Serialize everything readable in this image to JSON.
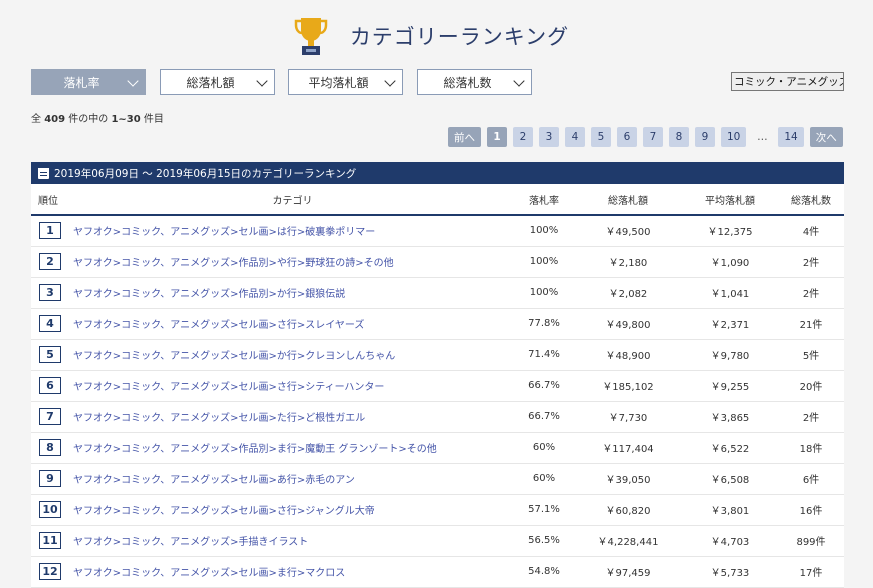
{
  "page_title": "カテゴリーランキング",
  "filters": [
    {
      "label": "落札率",
      "active": true
    },
    {
      "label": "総落札額",
      "active": false
    },
    {
      "label": "平均落札額",
      "active": false
    },
    {
      "label": "総落札数",
      "active": false
    }
  ],
  "category_select": {
    "value": "コミック・アニメグッズ"
  },
  "count": {
    "prefix": "全",
    "total": "409",
    "mid": "件の中の",
    "range": "1~30",
    "suffix": "件目"
  },
  "pager": {
    "prev": "前へ",
    "pages": [
      "1",
      "2",
      "3",
      "4",
      "5",
      "6",
      "7",
      "8",
      "9",
      "10"
    ],
    "current": "1",
    "ellipsis": "…",
    "last": "14",
    "next": "次へ"
  },
  "table": {
    "title": "2019年06月09日 ～ 2019年06月15日のカテゴリーランキング",
    "headers": {
      "rank": "順位",
      "category": "カテゴリ",
      "rate": "落札率",
      "total": "総落札額",
      "avg": "平均落札額",
      "bids": "総落札数"
    },
    "rows": [
      {
        "rank": "1",
        "category": "ヤフオク>コミック、アニメグッズ>セル画>は行>破裏拳ポリマー",
        "rate": "100%",
        "total": "￥49,500",
        "avg": "￥12,375",
        "bids": "4件"
      },
      {
        "rank": "2",
        "category": "ヤフオク>コミック、アニメグッズ>作品別>や行>野球狂の詩>その他",
        "rate": "100%",
        "total": "￥2,180",
        "avg": "￥1,090",
        "bids": "2件"
      },
      {
        "rank": "3",
        "category": "ヤフオク>コミック、アニメグッズ>作品別>か行>銀狼伝説",
        "rate": "100%",
        "total": "￥2,082",
        "avg": "￥1,041",
        "bids": "2件"
      },
      {
        "rank": "4",
        "category": "ヤフオク>コミック、アニメグッズ>セル画>さ行>スレイヤーズ",
        "rate": "77.8%",
        "total": "￥49,800",
        "avg": "￥2,371",
        "bids": "21件"
      },
      {
        "rank": "5",
        "category": "ヤフオク>コミック、アニメグッズ>セル画>か行>クレヨンしんちゃん",
        "rate": "71.4%",
        "total": "￥48,900",
        "avg": "￥9,780",
        "bids": "5件"
      },
      {
        "rank": "6",
        "category": "ヤフオク>コミック、アニメグッズ>セル画>さ行>シティーハンター",
        "rate": "66.7%",
        "total": "￥185,102",
        "avg": "￥9,255",
        "bids": "20件"
      },
      {
        "rank": "7",
        "category": "ヤフオク>コミック、アニメグッズ>セル画>た行>ど根性ガエル",
        "rate": "66.7%",
        "total": "￥7,730",
        "avg": "￥3,865",
        "bids": "2件"
      },
      {
        "rank": "8",
        "category": "ヤフオク>コミック、アニメグッズ>作品別>ま行>魔動王 グランゾート>その他",
        "rate": "60%",
        "total": "￥117,404",
        "avg": "￥6,522",
        "bids": "18件"
      },
      {
        "rank": "9",
        "category": "ヤフオク>コミック、アニメグッズ>セル画>あ行>赤毛のアン",
        "rate": "60%",
        "total": "￥39,050",
        "avg": "￥6,508",
        "bids": "6件"
      },
      {
        "rank": "10",
        "category": "ヤフオク>コミック、アニメグッズ>セル画>さ行>ジャングル大帝",
        "rate": "57.1%",
        "total": "￥60,820",
        "avg": "￥3,801",
        "bids": "16件"
      },
      {
        "rank": "11",
        "category": "ヤフオク>コミック、アニメグッズ>手描きイラスト",
        "rate": "56.5%",
        "total": "￥4,228,441",
        "avg": "￥4,703",
        "bids": "899件"
      },
      {
        "rank": "12",
        "category": "ヤフオク>コミック、アニメグッズ>セル画>ま行>マクロス",
        "rate": "54.8%",
        "total": "￥97,459",
        "avg": "￥5,733",
        "bids": "17件"
      }
    ]
  },
  "colors": {
    "header_bar": "#1f3a6b",
    "link": "#4454a8",
    "button_active": "#97a4b8",
    "page_chip": "#c9d3e6"
  }
}
